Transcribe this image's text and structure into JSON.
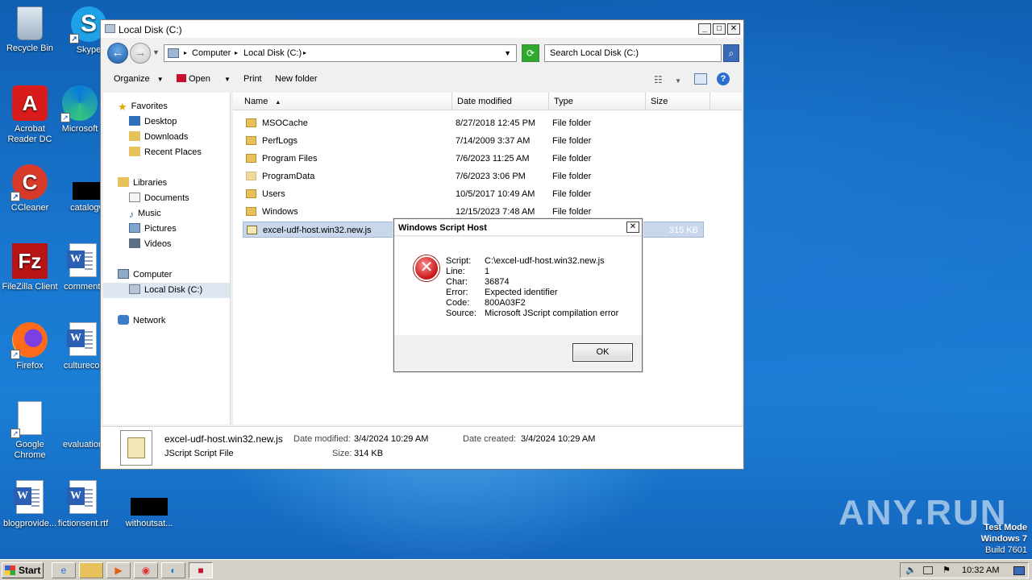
{
  "desktop": {
    "icons": [
      {
        "label": "Recycle Bin"
      },
      {
        "label": "Skype"
      },
      {
        "label": "Acrobat Reader DC"
      },
      {
        "label": "Microsoft"
      },
      {
        "label": "CCleaner"
      },
      {
        "label": "catalogwi"
      },
      {
        "label": "FileZilla Client"
      },
      {
        "label": "commentl"
      },
      {
        "label": "Firefox"
      },
      {
        "label": "culturecor"
      },
      {
        "label": "Google Chrome"
      },
      {
        "label": "evaluation"
      },
      {
        "label": "blogprovide..."
      },
      {
        "label": "fictionsent.rtf"
      },
      {
        "label": "withoutsat..."
      }
    ]
  },
  "explorer": {
    "title": "Local Disk (C:)",
    "breadcrumb": [
      "Computer",
      "Local Disk (C:)"
    ],
    "search_placeholder": "Search Local Disk (C:)",
    "toolbar": {
      "organize": "Organize",
      "open": "Open",
      "print": "Print",
      "new_folder": "New folder"
    },
    "nav": {
      "favorites": "Favorites",
      "desktop": "Desktop",
      "downloads": "Downloads",
      "recent": "Recent Places",
      "libraries": "Libraries",
      "documents": "Documents",
      "music": "Music",
      "pictures": "Pictures",
      "videos": "Videos",
      "computer": "Computer",
      "local_disk": "Local Disk (C:)",
      "network": "Network"
    },
    "columns": {
      "name": "Name",
      "date": "Date modified",
      "type": "Type",
      "size": "Size"
    },
    "files": [
      {
        "name": "MSOCache",
        "date": "8/27/2018 12:45 PM",
        "type": "File folder",
        "size": ""
      },
      {
        "name": "PerfLogs",
        "date": "7/14/2009 3:37 AM",
        "type": "File folder",
        "size": ""
      },
      {
        "name": "Program Files",
        "date": "7/6/2023 11:25 AM",
        "type": "File folder",
        "size": ""
      },
      {
        "name": "ProgramData",
        "date": "7/6/2023 3:06 PM",
        "type": "File folder",
        "size": ""
      },
      {
        "name": "Users",
        "date": "10/5/2017 10:49 AM",
        "type": "File folder",
        "size": ""
      },
      {
        "name": "Windows",
        "date": "12/15/2023 7:48 AM",
        "type": "File folder",
        "size": ""
      },
      {
        "name": "excel-udf-host.win32.new.js",
        "date": "",
        "type": "",
        "size": "315 KB"
      }
    ],
    "details": {
      "filename": "excel-udf-host.win32.new.js",
      "modified_label": "Date modified:",
      "modified": "3/4/2024 10:29 AM",
      "created_label": "Date created:",
      "created": "3/4/2024 10:29 AM",
      "filetype": "JScript Script File",
      "size_label": "Size:",
      "size": "314 KB"
    }
  },
  "dialog": {
    "title": "Windows Script Host",
    "lines": [
      {
        "k": "Script:",
        "v": "C:\\excel-udf-host.win32.new.js"
      },
      {
        "k": "Line:",
        "v": "1"
      },
      {
        "k": "Char:",
        "v": "36874"
      },
      {
        "k": "Error:",
        "v": "Expected identifier"
      },
      {
        "k": "Code:",
        "v": "800A03F2"
      },
      {
        "k": "Source:",
        "v": "Microsoft JScript compilation error"
      }
    ],
    "ok": "OK"
  },
  "taskbar": {
    "start": "Start",
    "clock": "10:32 AM"
  },
  "watermark": {
    "line1": "Test Mode",
    "line2": "Windows 7",
    "line3": "Build 7601",
    "brand": "ANY.RUN"
  }
}
